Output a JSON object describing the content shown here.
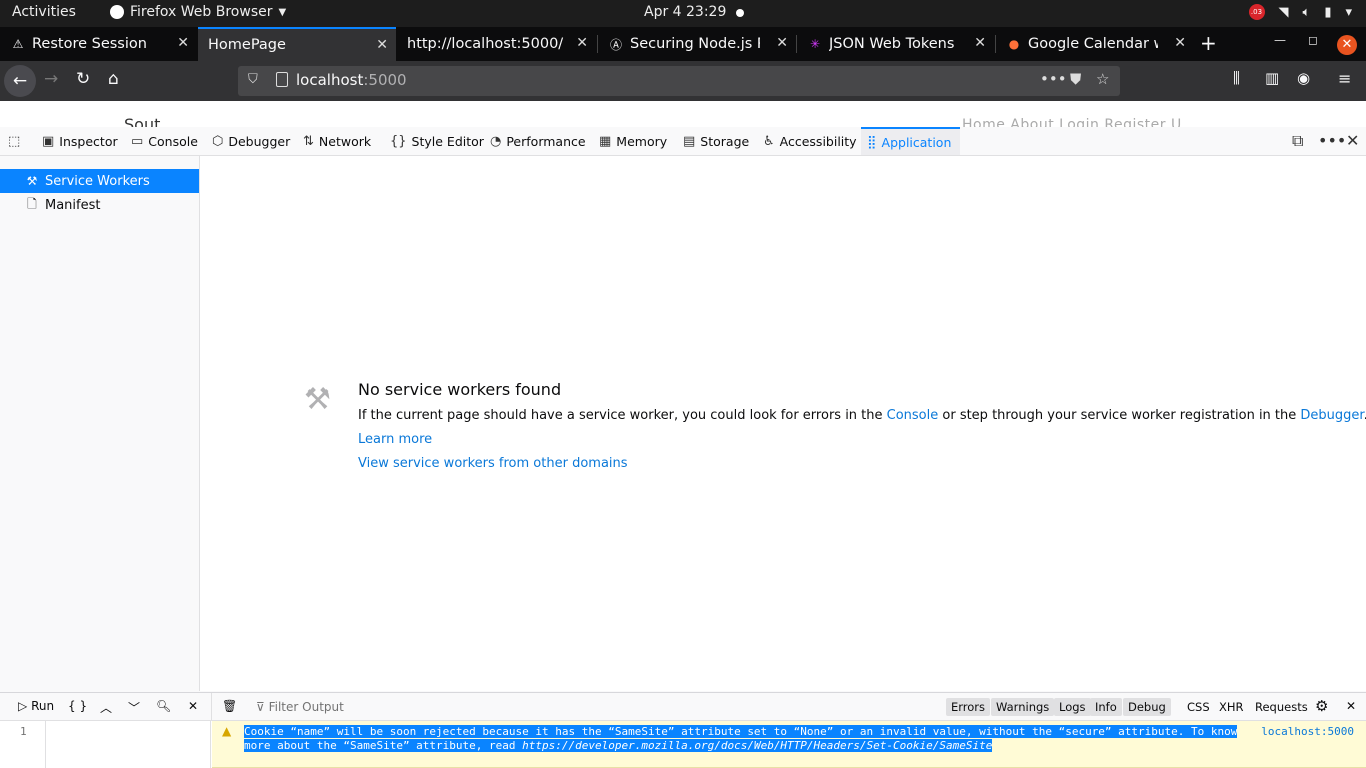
{
  "system_bar": {
    "activities": "Activities",
    "app_name": "Firefox Web Browser",
    "clock": "Apr 4  23:29",
    "battery_badge": ".03"
  },
  "tabs": [
    {
      "label": "Restore Session",
      "icon": "warning-icon"
    },
    {
      "label": "HomePage",
      "icon": "none",
      "active": true
    },
    {
      "label": "http://localhost:5000/",
      "icon": "none"
    },
    {
      "label": "Securing Node.js RES",
      "icon": "auth0-icon"
    },
    {
      "label": "JSON Web Tokens - j",
      "icon": "jwt-icon"
    },
    {
      "label": "Google Calendar will",
      "icon": "firefox-icon"
    }
  ],
  "url_bar": {
    "host": "localhost",
    "port": ":5000"
  },
  "page_peek": {
    "logo_text": "Sout ...",
    "nav_text": "Home   About   Login   Register   U"
  },
  "devtools_tabs": [
    {
      "label": "Inspector",
      "icon": "inspector-icon"
    },
    {
      "label": "Console",
      "icon": "console-icon"
    },
    {
      "label": "Debugger",
      "icon": "debugger-icon"
    },
    {
      "label": "Network",
      "icon": "network-icon"
    },
    {
      "label": "Style Editor",
      "icon": "style-editor-icon"
    },
    {
      "label": "Performance",
      "icon": "performance-icon"
    },
    {
      "label": "Memory",
      "icon": "memory-icon"
    },
    {
      "label": "Storage",
      "icon": "storage-icon"
    },
    {
      "label": "Accessibility",
      "icon": "accessibility-icon"
    },
    {
      "label": "Application",
      "icon": "application-icon",
      "active": true
    }
  ],
  "sidebar": {
    "items": [
      {
        "label": "Service Workers",
        "icon": "tools-icon",
        "selected": true
      },
      {
        "label": "Manifest",
        "icon": "document-icon"
      }
    ]
  },
  "empty_state": {
    "title": "No service workers found",
    "text_before": "If the current page should have a service worker, you could look for errors in the ",
    "console_link": "Console",
    "text_middle": " or step through your service worker registration in the ",
    "debugger_link": "Debugger",
    "text_after": ".",
    "learn_more": "Learn more",
    "other_domains": "View service workers from other domains"
  },
  "console": {
    "run_label": "Run",
    "braces": "{ }",
    "filter_placeholder": "Filter Output",
    "filters": [
      "Errors",
      "Warnings",
      "Logs",
      "Info",
      "Debug"
    ],
    "extra_filters": [
      "CSS",
      "XHR",
      "Requests"
    ],
    "line_number": "1",
    "message_line1": "Cookie “name” will be soon rejected because it has the “SameSite” attribute set to “None” or an invalid value, without the “secure” attribute. To know",
    "message_line2": "more about the “SameSite” attribute, read ",
    "message_url": "https://developer.mozilla.org/docs/Web/HTTP/Headers/Set-Cookie/SameSite",
    "message_source": "localhost:5000"
  },
  "colors": {
    "accent": "#0a84ff",
    "warning_bg": "#fffbd6",
    "ubuntu_close": "#e95420"
  }
}
